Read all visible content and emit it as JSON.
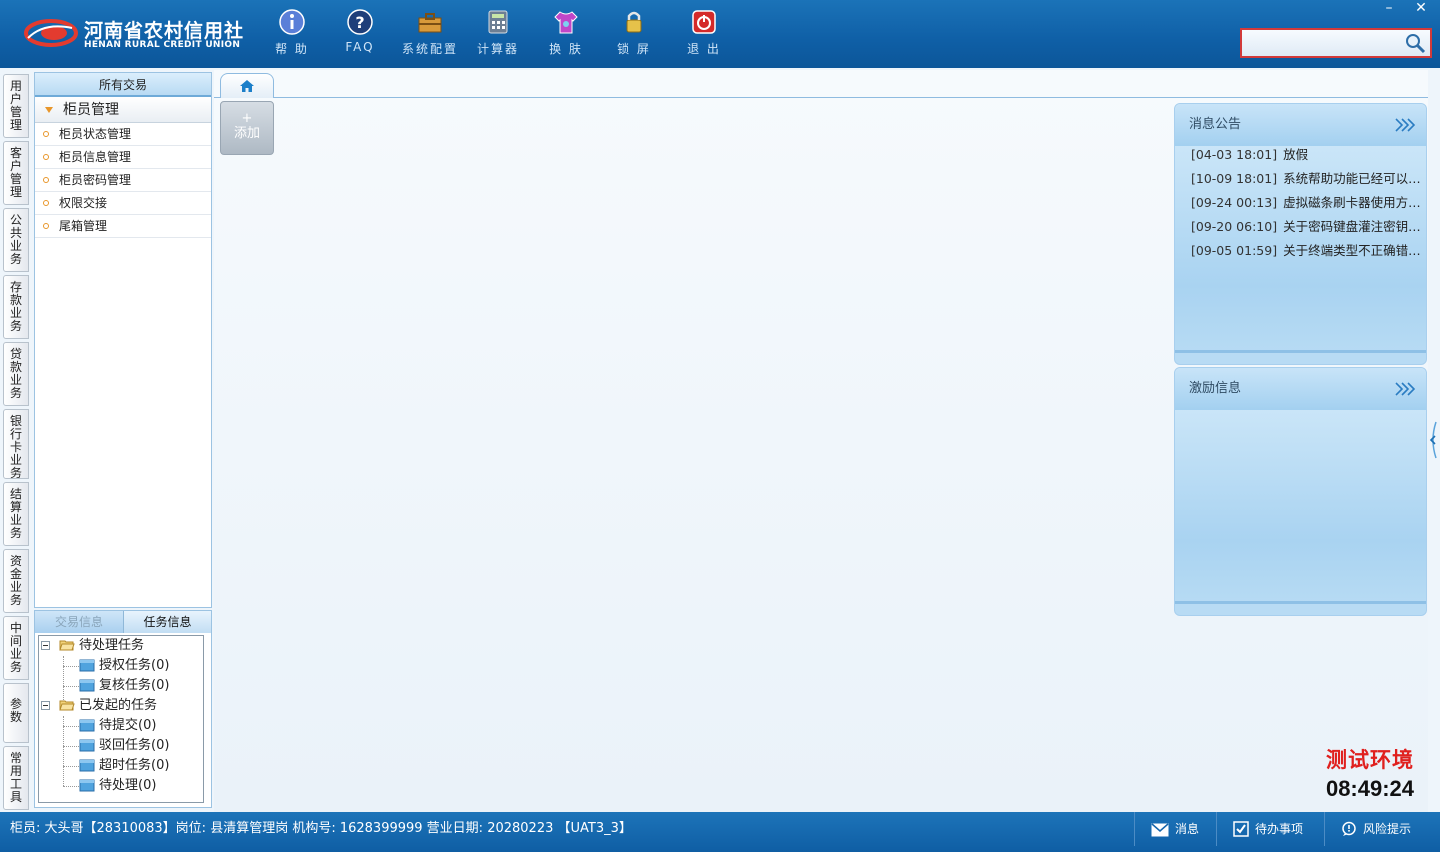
{
  "header": {
    "logo_cn": "河南省农村信用社",
    "logo_en": "HENAN RURAL CREDIT UNION",
    "toolbar": [
      {
        "label": "帮 助",
        "icon": "info-icon"
      },
      {
        "label": "FAQ",
        "icon": "help-icon"
      },
      {
        "label": "系统配置",
        "icon": "toolbox-icon"
      },
      {
        "label": "计算器",
        "icon": "calculator-icon"
      },
      {
        "label": "换 肤",
        "icon": "shirt-icon"
      },
      {
        "label": "锁 屏",
        "icon": "lock-icon"
      },
      {
        "label": "退 出",
        "icon": "power-icon"
      }
    ],
    "window_controls": {
      "minimize": "–",
      "close": "✕"
    },
    "search": {
      "value": "",
      "placeholder": ""
    }
  },
  "vertical_tabs": [
    "用户管理",
    "客户管理",
    "公共业务",
    "存款业务",
    "贷款业务",
    "银行卡业务",
    "结算业务",
    "资金业务",
    "中间业务",
    "参数",
    "常用工具"
  ],
  "menu": {
    "title": "所有交易",
    "group": "柜员管理",
    "items": [
      "柜员状态管理",
      "柜员信息管理",
      "柜员密码管理",
      "权限交接",
      "尾箱管理"
    ]
  },
  "tasks": {
    "tabs": [
      "交易信息",
      "任务信息"
    ],
    "active_tab": "任务信息",
    "tree": {
      "pending": {
        "label": "待处理任务",
        "children": [
          "授权任务(0)",
          "复核任务(0)"
        ]
      },
      "initiated": {
        "label": "已发起的任务",
        "children": [
          "待提交(0)",
          "驳回任务(0)",
          "超时任务(0)",
          "待处理(0)"
        ]
      }
    }
  },
  "content": {
    "home_tab_icon": "home-icon",
    "add_button": {
      "plus": "+",
      "label": "添加"
    }
  },
  "notices": {
    "title": "消息公告",
    "items": [
      {
        "time": "[04-03 18:01]",
        "text": "放假"
      },
      {
        "time": "[10-09 18:01]",
        "text": "系统帮助功能已经可以使用"
      },
      {
        "time": "[09-24 00:13]",
        "text": "虚拟磁条刷卡器使用方法说明"
      },
      {
        "time": "[09-20 06:10]",
        "text": "关于密码键盘灌注密钥的说明"
      },
      {
        "time": "[09-05 01:59]",
        "text": "关于终端类型不正确错误的处理"
      }
    ]
  },
  "incentive": {
    "title": "激励信息"
  },
  "environment": {
    "label": "测试环境",
    "clock": "08:49:24"
  },
  "statusbar": {
    "text": "柜员: 大头哥【28310083】岗位: 县清算管理岗  机构号: 1628399999  营业日期: 20280223 【UAT3_3】",
    "buttons": {
      "message": "消息",
      "todo": "待办事项",
      "risk": "风险提示"
    }
  },
  "colors": {
    "header": "#1566ad",
    "accent_red": "#e0201e",
    "statusbar": "#1566ad"
  }
}
